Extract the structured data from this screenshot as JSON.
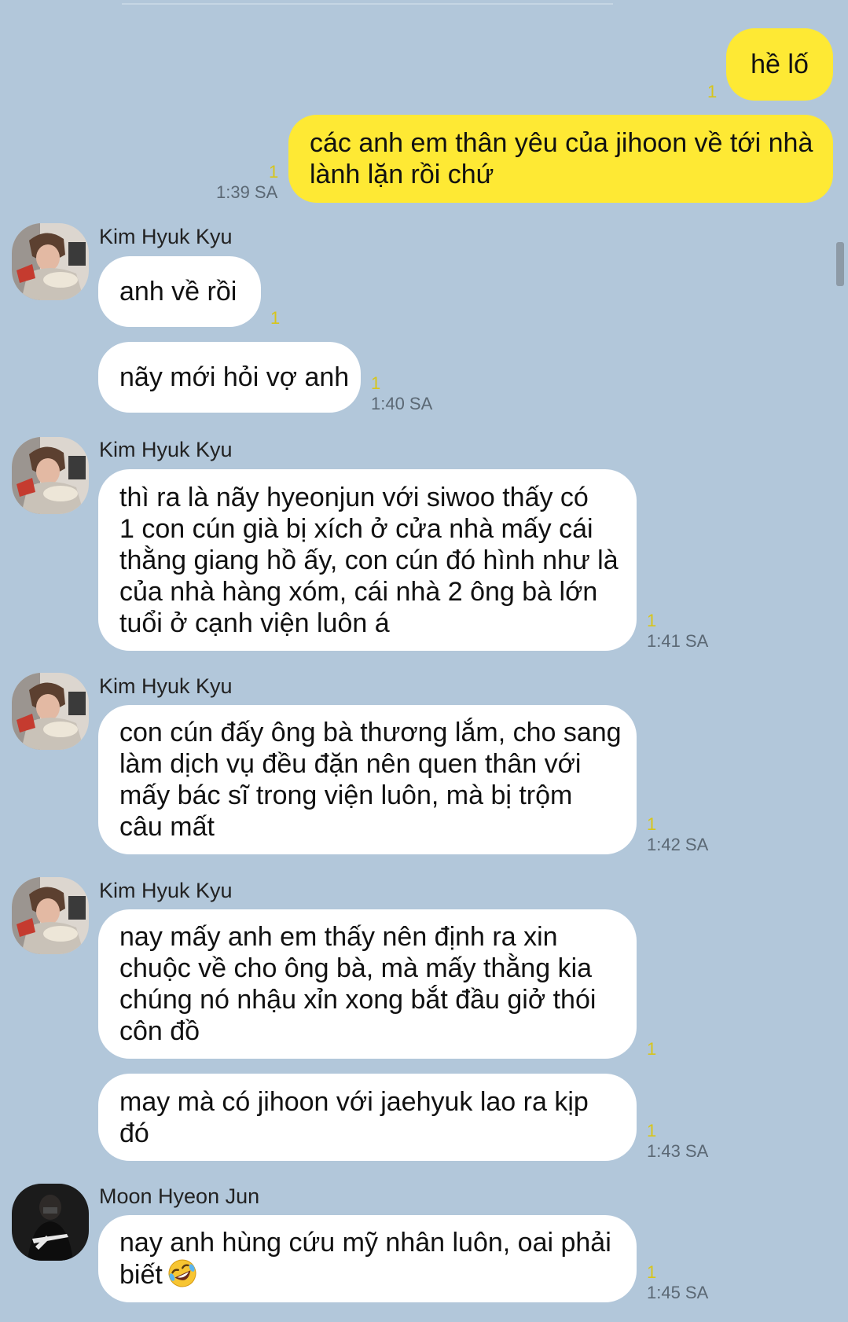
{
  "chat": {
    "messages": [
      {
        "text_lines": [
          "hề lố"
        ],
        "unread": "1",
        "time": ""
      },
      {
        "text_lines": [
          "các anh em thân yêu của jihoon về tới nhà",
          "lành lặn rồi chứ"
        ],
        "unread": "1",
        "time": "1:39 SA"
      },
      {
        "sender": "Kim Hyuk Kyu",
        "text_lines": [
          "anh về rồi"
        ],
        "unread": "1",
        "time": ""
      },
      {
        "text_lines": [
          "nãy mới hỏi vợ anh"
        ],
        "unread": "1",
        "time": "1:40 SA"
      },
      {
        "sender": "Kim Hyuk Kyu",
        "text_lines": [
          "thì ra là nãy hyeonjun với siwoo thấy có",
          "1 con cún già bị xích ở cửa nhà mấy cái",
          "thằng giang hồ ấy, con cún đó hình như là",
          "của nhà hàng xóm, cái nhà 2 ông bà lớn",
          "tuổi ở cạnh viện luôn á"
        ],
        "unread": "1",
        "time": "1:41 SA"
      },
      {
        "sender": "Kim Hyuk Kyu",
        "text_lines": [
          "con cún đấy ông bà thương lắm, cho sang",
          "làm dịch vụ đều đặn nên quen thân với",
          "mấy bác sĩ trong viện luôn,  mà bị trộm",
          "câu mất"
        ],
        "unread": "1",
        "time": "1:42 SA"
      },
      {
        "sender": "Kim Hyuk Kyu",
        "text_lines": [
          "nay mấy anh em thấy nên định ra xin",
          "chuộc về cho ông bà, mà mấy thằng kia",
          "chúng nó nhậu xỉn xong bắt đầu giở thói",
          "côn đồ"
        ],
        "unread": "1",
        "time": ""
      },
      {
        "text_lines": [
          "may mà có jihoon với jaehyuk lao ra kịp",
          "đó"
        ],
        "unread": "1",
        "time": "1:43 SA"
      },
      {
        "sender": "Moon Hyeon Jun",
        "text_lines": [
          "nay anh hùng cứu mỹ nhân luôn, oai phải",
          "biết"
        ],
        "emoji": "rolling-on-floor-laughing",
        "unread": "1",
        "time": "1:45 SA"
      }
    ]
  },
  "colors": {
    "background": "#b2c7da",
    "my_bubble": "#fee934",
    "their_bubble": "#ffffff",
    "unread_count": "#d7c51a",
    "timestamp": "#5b6874"
  }
}
